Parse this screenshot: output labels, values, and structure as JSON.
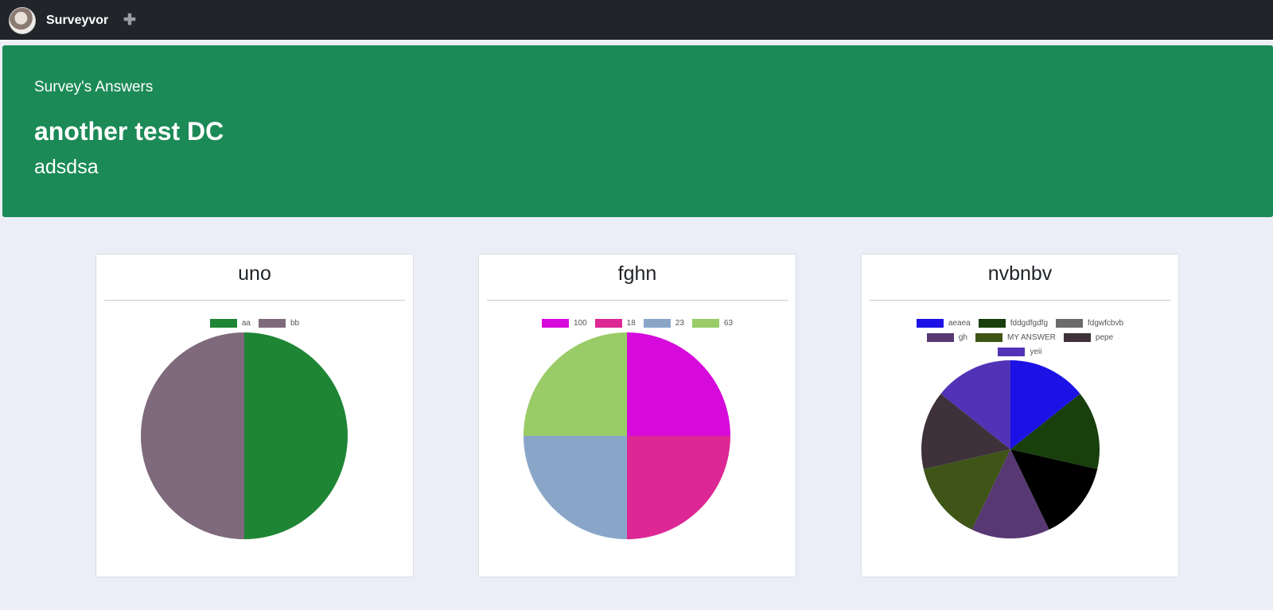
{
  "navbar": {
    "brand": "Surveyvor",
    "add_icon": "plus-icon",
    "avatar_icon": "avatar-icon"
  },
  "header": {
    "subtitle": "Survey's Answers",
    "title": "another test DC",
    "description": "adsdsa"
  },
  "colors": {
    "navbar_bg": "#212529",
    "header_bg": "#1b8a56",
    "page_bg": "#ebedf7"
  },
  "chart_data": [
    {
      "type": "pie",
      "title": "uno",
      "categories": [
        "aa",
        "bb"
      ],
      "values": [
        1,
        1
      ],
      "colors": [
        "#1e8535",
        "#7e6a7c"
      ],
      "legend": "top"
    },
    {
      "type": "pie",
      "title": "fghn",
      "categories": [
        "100",
        "18",
        "23",
        "63"
      ],
      "values": [
        1,
        1,
        1,
        1
      ],
      "colors": [
        "#d60adb",
        "#dc2794",
        "#89a6c9",
        "#99cc66"
      ],
      "legend": "top"
    },
    {
      "type": "pie",
      "title": "nvbnbv",
      "categories": [
        "aeaea",
        "fddgdfgdfg",
        "fdgwfcbvb",
        "gh",
        "MY ANSWER",
        "pepe",
        "yeii"
      ],
      "values": [
        1,
        1,
        1,
        1,
        1,
        1,
        1
      ],
      "colors": [
        "#1c12e6",
        "#183f0c",
        "#000000",
        "#573873",
        "#3e5517",
        "#3e313a",
        "#5232b6"
      ],
      "legend_colors": [
        "#1c12e6",
        "#183f0c",
        "#6b6b6b",
        "#573873",
        "#3e5517",
        "#3e313a",
        "#5232b6"
      ],
      "legend": "top"
    }
  ]
}
